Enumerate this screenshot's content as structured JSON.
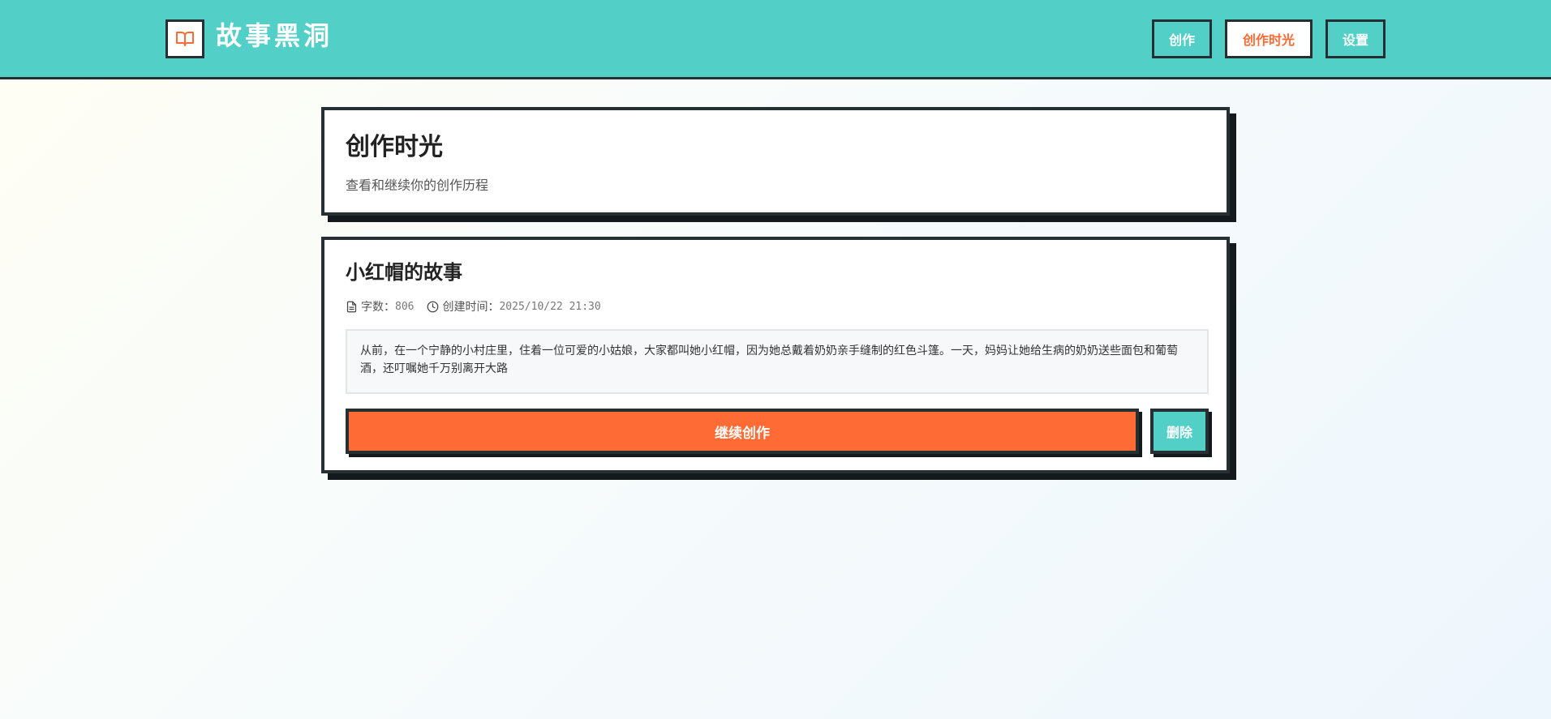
{
  "header": {
    "logo_icon": "open-book-icon",
    "app_title": "故事黑洞",
    "nav": [
      {
        "label": "创作",
        "active": false
      },
      {
        "label": "创作时光",
        "active": true
      },
      {
        "label": "设置",
        "active": false
      }
    ]
  },
  "page": {
    "title": "创作时光",
    "subtitle": "查看和继续你的创作历程"
  },
  "stories": [
    {
      "title": "小红帽的故事",
      "word_count_label": "字数：",
      "word_count": "806",
      "created_label": "创建时间：",
      "created_at": "2025/10/22 21:30",
      "excerpt": "从前，在一个宁静的小村庄里，住着一位可爱的小姑娘，大家都叫她小红帽，因为她总戴着奶奶亲手缝制的红色斗篷。一天，妈妈让她给生病的奶奶送些面包和葡萄酒，还叮嘱她千万别离开大路",
      "continue_label": "继续创作",
      "delete_label": "删除"
    }
  ],
  "colors": {
    "header_bg": "#52cfc6",
    "accent": "#ff6b35",
    "border": "#263032"
  }
}
